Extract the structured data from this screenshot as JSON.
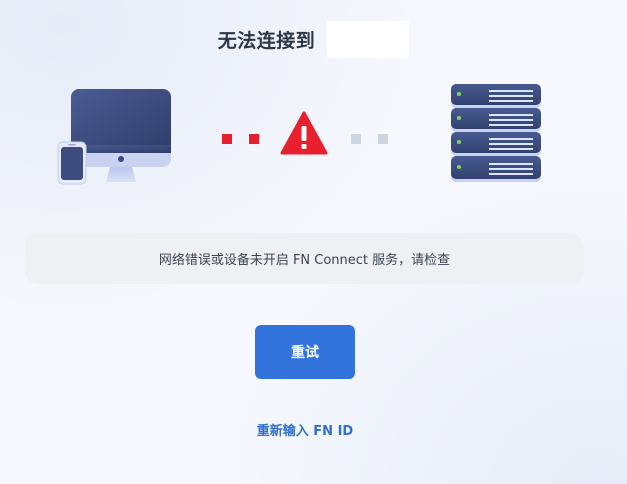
{
  "title": "无法连接到",
  "message": "网络错误或设备未开启 FN Connect 服务，请检查",
  "retry_label": "重试",
  "reenter_label": "重新输入 FN ID",
  "colors": {
    "accent": "#3273dc",
    "error": "#e8202e",
    "device_dark": "#3a4a7c",
    "inactive_dot": "#cdd5e0"
  },
  "icons": [
    "monitor-icon",
    "phone-icon",
    "warning-icon",
    "server-icon"
  ]
}
